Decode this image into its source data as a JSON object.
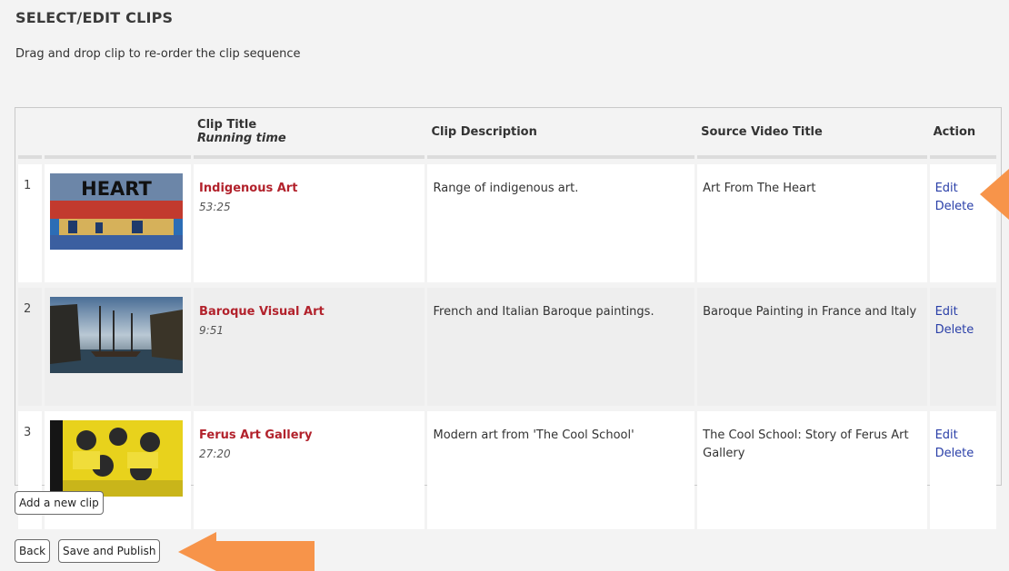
{
  "header": {
    "title": "SELECT/EDIT CLIPS",
    "subtitle": "Drag and drop clip to re-order the clip sequence"
  },
  "table": {
    "columns": {
      "clip_title": "Clip Title",
      "running_time": "Running time",
      "description": "Clip Description",
      "source": "Source Video Title",
      "action": "Action"
    },
    "rows": [
      {
        "num": "1",
        "thumb_text": "HEART",
        "title": "Indigenous Art",
        "time": "53:25",
        "description": "Range of indigenous art.",
        "source": "Art From The Heart",
        "edit": "Edit",
        "delete": "Delete"
      },
      {
        "num": "2",
        "thumb_text": "",
        "title": "Baroque Visual Art",
        "time": "9:51",
        "description": "French and Italian Baroque paintings.",
        "source": "Baroque Painting in France and Italy",
        "edit": "Edit",
        "delete": "Delete"
      },
      {
        "num": "3",
        "thumb_text": "",
        "title": "Ferus Art Gallery",
        "time": "27:20",
        "description": "Modern art from 'The Cool School'",
        "source": "The Cool School: Story of Ferus Art Gallery",
        "edit": "Edit",
        "delete": "Delete"
      }
    ]
  },
  "buttons": {
    "add_clip": "Add a new clip",
    "back": "Back",
    "save_publish": "Save and Publish"
  },
  "colors": {
    "accent_arrow": "#f7944a",
    "clip_title": "#b2222c",
    "link": "#2a3fa8"
  }
}
